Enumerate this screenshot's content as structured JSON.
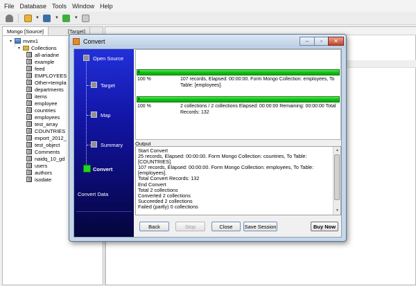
{
  "menu": [
    "File",
    "Database",
    "Tools",
    "Window",
    "Help"
  ],
  "left_panel": {
    "tab_source": "Mongo [Source]",
    "tab_target": "[Target]",
    "db_name": "mvex1",
    "collections_label": "Collections",
    "collections": [
      "all-ariadne",
      "example",
      "feed",
      "EMPLOYEES",
      "Other+templa",
      "departments",
      "items",
      "employee",
      "countries",
      "employees",
      "test_array",
      "COUNTRIES",
      "export_2012_",
      "test_object",
      "Comments",
      "naidq_10_gd",
      "users",
      "authors",
      "isodate"
    ]
  },
  "dialog": {
    "title": "Convert",
    "steps": [
      "Open Source",
      "Target",
      "Map",
      "Summary",
      "Convert"
    ],
    "active_step": "Convert",
    "convert_data_label": "Convert Data",
    "progress": [
      {
        "percent_text": "100 %",
        "value": 1.0,
        "text": "107 records,    Elapsed: 00:00:00.    Form Mongo Collection: employees,    To Table: [employees]."
      },
      {
        "percent_text": "100 %",
        "value": 1.0,
        "text": "2 collections / 2 collections    Elapsed: 00:00:00    Remaining: 00:00:00    Total Records: 132"
      }
    ],
    "output_label": "Output",
    "output_lines": [
      "Start Convert",
      "25 records,   Elapsed: 00:00:00.   Form Mongo Collection: countries,   To Table: [COUNTRIES].",
      "107 records,   Elapsed: 00:00:00.   Form Mongo Collection: employees,   To Table: [employees].",
      "Total Convert Records: 132",
      "End Convert",
      "Total 2 collections",
      "Converted 2 collections",
      "Succeeded 2 collections",
      "Failed (partly) 0 collections"
    ],
    "buttons": {
      "back": "Back",
      "stop": "Stop",
      "close": "Close",
      "save_session": "Save Session",
      "buy_now": "Buy Now"
    }
  },
  "colors": {
    "progress_green": "#12c012",
    "wizard_blue": "#1316a8",
    "active_step_green": "#1fd81f"
  }
}
